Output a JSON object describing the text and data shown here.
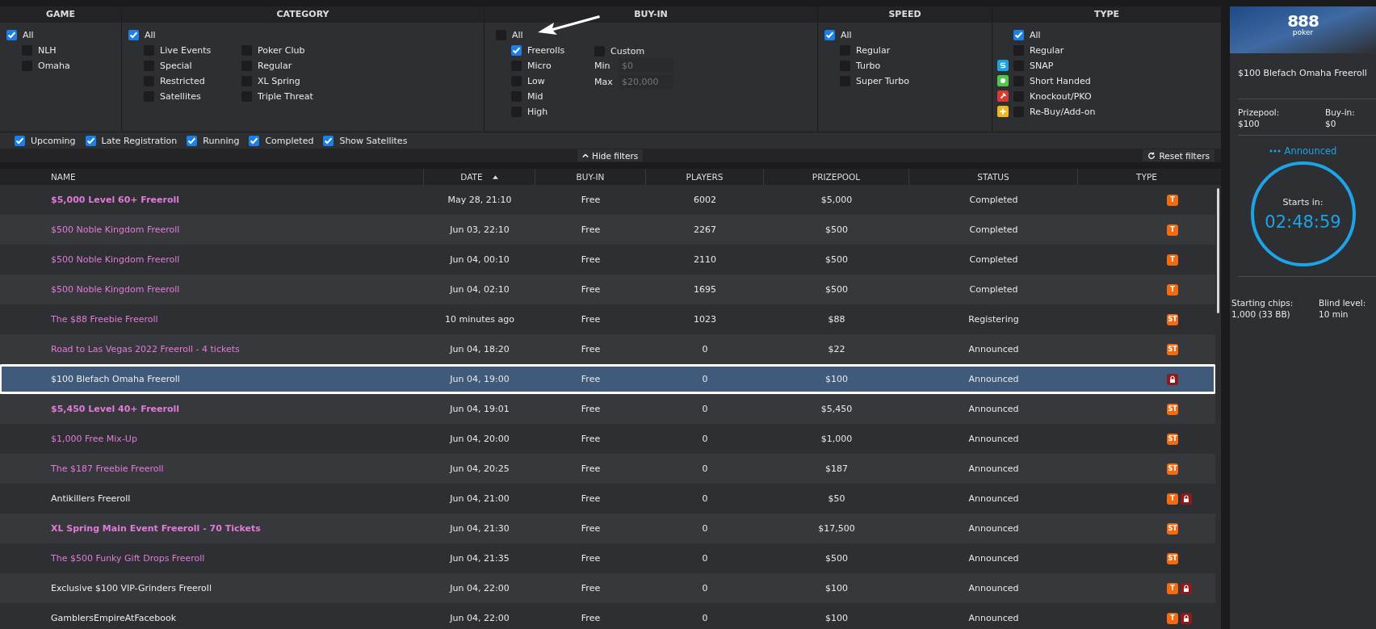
{
  "filters": {
    "game": {
      "title": "GAME",
      "all": {
        "label": "All",
        "checked": true
      },
      "items": [
        {
          "label": "NLH",
          "checked": false
        },
        {
          "label": "Omaha",
          "checked": false
        }
      ]
    },
    "category": {
      "title": "CATEGORY",
      "all": {
        "label": "All",
        "checked": true
      },
      "items": [
        {
          "label": "Live Events",
          "checked": false
        },
        {
          "label": "Poker Club",
          "checked": false
        },
        {
          "label": "Special",
          "checked": false
        },
        {
          "label": "Regular",
          "checked": false
        },
        {
          "label": "Restricted",
          "checked": false
        },
        {
          "label": "XL Spring",
          "checked": false
        },
        {
          "label": "Satellites",
          "checked": false
        },
        {
          "label": "Triple Threat",
          "checked": false
        }
      ]
    },
    "buyin": {
      "title": "BUY-IN",
      "all": {
        "label": "All",
        "checked": false
      },
      "items": [
        {
          "label": "Freerolls",
          "checked": true
        },
        {
          "label": "Micro",
          "checked": false
        },
        {
          "label": "Low",
          "checked": false
        },
        {
          "label": "Mid",
          "checked": false
        },
        {
          "label": "High",
          "checked": false
        }
      ],
      "custom": {
        "label": "Custom",
        "checked": false
      },
      "min": {
        "label": "Min",
        "placeholder": "$0"
      },
      "max": {
        "label": "Max",
        "placeholder": "$20,000"
      }
    },
    "speed": {
      "title": "SPEED",
      "all": {
        "label": "All",
        "checked": true
      },
      "items": [
        {
          "label": "Regular",
          "checked": false
        },
        {
          "label": "Turbo",
          "checked": false
        },
        {
          "label": "Super Turbo",
          "checked": false
        }
      ]
    },
    "type": {
      "title": "TYPE",
      "all": {
        "label": "All",
        "checked": true
      },
      "items": [
        {
          "label": "Regular",
          "checked": false,
          "kind": "plain"
        },
        {
          "label": "SNAP",
          "checked": false,
          "kind": "snap"
        },
        {
          "label": "Short Handed",
          "checked": false,
          "kind": "short"
        },
        {
          "label": "Knockout/PKO",
          "checked": false,
          "kind": "knockout"
        },
        {
          "label": "Re-Buy/Add-on",
          "checked": false,
          "kind": "rebuy"
        }
      ]
    },
    "status": [
      {
        "label": "Upcoming",
        "checked": true
      },
      {
        "label": "Late Registration",
        "checked": true
      },
      {
        "label": "Running",
        "checked": true
      },
      {
        "label": "Completed",
        "checked": true
      },
      {
        "label": "Show Satellites",
        "checked": true
      }
    ],
    "hide_button": "Hide filters",
    "reset_button": "Reset filters"
  },
  "table": {
    "columns": [
      {
        "label": "NAME",
        "sorted": false
      },
      {
        "label": "DATE",
        "sorted": true
      },
      {
        "label": "BUY-IN",
        "sorted": false
      },
      {
        "label": "PLAYERS",
        "sorted": false
      },
      {
        "label": "PRIZEPOOL",
        "sorted": false
      },
      {
        "label": "STATUS",
        "sorted": false
      },
      {
        "label": "TYPE",
        "sorted": false
      }
    ],
    "rows": [
      {
        "name": "$5,000 Level 60+ Freeroll",
        "highlighted": true,
        "bold": true,
        "date": "May 28, 21:10",
        "buyin": "Free",
        "players": "6002",
        "prizepool": "$5,000",
        "status": "Completed",
        "types": [
          "T"
        ],
        "locked": false,
        "selected": false
      },
      {
        "name": "$500 Noble Kingdom Freeroll",
        "highlighted": true,
        "bold": false,
        "date": "Jun 03, 22:10",
        "buyin": "Free",
        "players": "2267",
        "prizepool": "$500",
        "status": "Completed",
        "types": [
          "T"
        ],
        "locked": false,
        "selected": false
      },
      {
        "name": "$500 Noble Kingdom Freeroll",
        "highlighted": true,
        "bold": false,
        "date": "Jun 04, 00:10",
        "buyin": "Free",
        "players": "2110",
        "prizepool": "$500",
        "status": "Completed",
        "types": [
          "T"
        ],
        "locked": false,
        "selected": false
      },
      {
        "name": "$500 Noble Kingdom Freeroll",
        "highlighted": true,
        "bold": false,
        "date": "Jun 04, 02:10",
        "buyin": "Free",
        "players": "1695",
        "prizepool": "$500",
        "status": "Completed",
        "types": [
          "T"
        ],
        "locked": false,
        "selected": false
      },
      {
        "name": "The $88 Freebie Freeroll",
        "highlighted": true,
        "bold": false,
        "date": "10 minutes ago",
        "buyin": "Free",
        "players": "1023",
        "prizepool": "$88",
        "status": "Registering",
        "types": [
          "ST"
        ],
        "locked": false,
        "selected": false
      },
      {
        "name": "Road to Las Vegas 2022 Freeroll - 4 tickets",
        "highlighted": true,
        "bold": false,
        "date": "Jun 04, 18:20",
        "buyin": "Free",
        "players": "0",
        "prizepool": "$22",
        "status": "Announced",
        "types": [
          "ST"
        ],
        "locked": false,
        "selected": false
      },
      {
        "name": "$100 Blefach Omaha Freeroll",
        "highlighted": false,
        "bold": false,
        "date": "Jun 04, 19:00",
        "buyin": "Free",
        "players": "0",
        "prizepool": "$100",
        "status": "Announced",
        "types": [],
        "locked": true,
        "selected": true
      },
      {
        "name": "$5,450 Level 40+ Freeroll",
        "highlighted": true,
        "bold": true,
        "date": "Jun 04, 19:01",
        "buyin": "Free",
        "players": "0",
        "prizepool": "$5,450",
        "status": "Announced",
        "types": [
          "ST"
        ],
        "locked": false,
        "selected": false
      },
      {
        "name": "$1,000 Free Mix-Up",
        "highlighted": true,
        "bold": false,
        "date": "Jun 04, 20:00",
        "buyin": "Free",
        "players": "0",
        "prizepool": "$1,000",
        "status": "Announced",
        "types": [
          "ST"
        ],
        "locked": false,
        "selected": false
      },
      {
        "name": "The $187 Freebie Freeroll",
        "highlighted": true,
        "bold": false,
        "date": "Jun 04, 20:25",
        "buyin": "Free",
        "players": "0",
        "prizepool": "$187",
        "status": "Announced",
        "types": [
          "ST"
        ],
        "locked": false,
        "selected": false
      },
      {
        "name": "Antikillers Freeroll",
        "highlighted": false,
        "bold": false,
        "date": "Jun 04, 21:00",
        "buyin": "Free",
        "players": "0",
        "prizepool": "$50",
        "status": "Announced",
        "types": [
          "T"
        ],
        "locked": true,
        "selected": false
      },
      {
        "name": "XL Spring Main Event Freeroll - 70 Tickets",
        "highlighted": true,
        "bold": true,
        "date": "Jun 04, 21:30",
        "buyin": "Free",
        "players": "0",
        "prizepool": "$17,500",
        "status": "Announced",
        "types": [
          "ST"
        ],
        "locked": false,
        "selected": false
      },
      {
        "name": "The $500 Funky Gift Drops Freeroll",
        "highlighted": true,
        "bold": false,
        "date": "Jun 04, 21:35",
        "buyin": "Free",
        "players": "0",
        "prizepool": "$500",
        "status": "Announced",
        "types": [
          "ST"
        ],
        "locked": false,
        "selected": false
      },
      {
        "name": "Exclusive $100 VIP-Grinders Freeroll",
        "highlighted": false,
        "bold": false,
        "date": "Jun 04, 22:00",
        "buyin": "Free",
        "players": "0",
        "prizepool": "$100",
        "status": "Announced",
        "types": [
          "T"
        ],
        "locked": true,
        "selected": false
      },
      {
        "name": "GamblersEmpireAtFacebook",
        "highlighted": false,
        "bold": false,
        "date": "Jun 04, 22:00",
        "buyin": "Free",
        "players": "0",
        "prizepool": "$100",
        "status": "Announced",
        "types": [
          "T"
        ],
        "locked": true,
        "selected": false
      }
    ]
  },
  "details": {
    "logo": {
      "mark": "888",
      "word": "poker"
    },
    "title": "$100 Blefach Omaha Freeroll",
    "prizepool": {
      "label": "Prizepool:",
      "value": "$100"
    },
    "buyin": {
      "label": "Buy-in:",
      "value": "$0"
    },
    "status": "Announced",
    "timer_label": "Starts in:",
    "timer": "02:48:59",
    "chips": {
      "label": "Starting chips:",
      "value": "1,000 (33 BB)"
    },
    "blind": {
      "label": "Blind level:",
      "value": "10 min"
    }
  }
}
